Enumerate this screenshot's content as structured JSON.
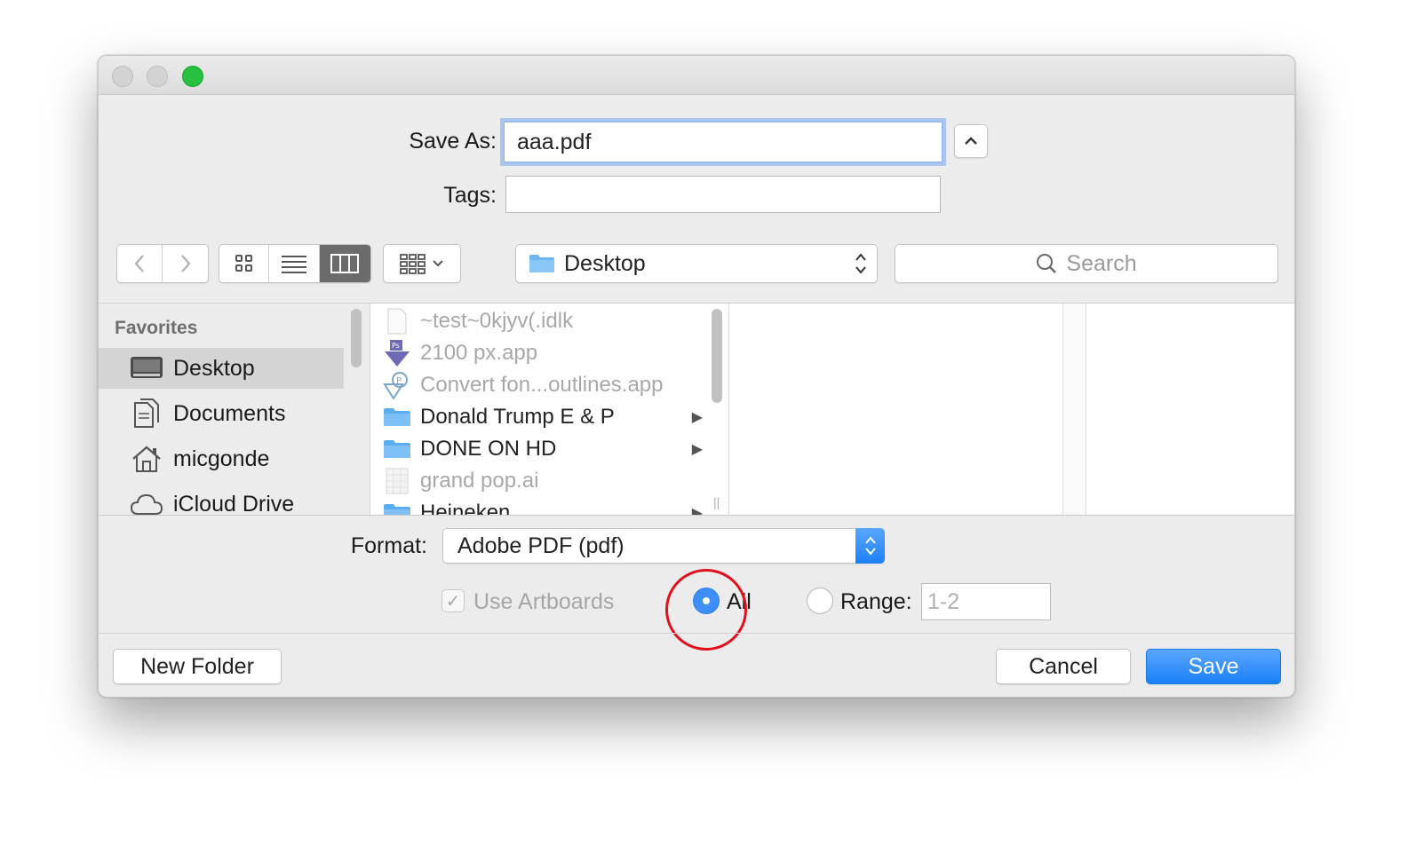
{
  "dialog": {
    "save_as_label": "Save As:",
    "save_as_value": "aaa.pdf",
    "tags_label": "Tags:",
    "tags_value": "",
    "location": "Desktop",
    "search_placeholder": "Search",
    "format_label": "Format:",
    "format_value": "Adobe PDF (pdf)",
    "use_artboards_label": "Use Artboards",
    "use_artboards_checked": true,
    "all_label": "All",
    "range_label": "Range:",
    "range_value": "1-2",
    "new_folder_label": "New Folder",
    "cancel_label": "Cancel",
    "save_label": "Save"
  },
  "sidebar": {
    "heading": "Favorites",
    "items": [
      {
        "label": "Desktop",
        "icon": "desktop-icon",
        "selected": true
      },
      {
        "label": "Documents",
        "icon": "documents-icon"
      },
      {
        "label": "micgonde",
        "icon": "home-icon"
      },
      {
        "label": "iCloud Drive",
        "icon": "cloud-icon"
      }
    ]
  },
  "files": [
    {
      "name": "~test~0kjyv(.idlk",
      "icon": "document-icon",
      "enabled": false
    },
    {
      "name": "2100 px.app",
      "icon": "photoshop-droplet-icon",
      "enabled": false
    },
    {
      "name": "Convert fon...outlines.app",
      "icon": "illustrator-droplet-icon",
      "enabled": false
    },
    {
      "name": "Donald Trump E & P",
      "icon": "folder-icon",
      "enabled": true,
      "folder": true
    },
    {
      "name": "DONE ON HD",
      "icon": "folder-icon",
      "enabled": true,
      "folder": true
    },
    {
      "name": "grand pop.ai",
      "icon": "ai-file-icon",
      "enabled": false
    },
    {
      "name": "Heineken",
      "icon": "folder-icon",
      "enabled": true,
      "folder": true
    }
  ],
  "colors": {
    "accent": "#1b80f6",
    "close_light": "#27c13f",
    "annotation": "#e0101c"
  }
}
